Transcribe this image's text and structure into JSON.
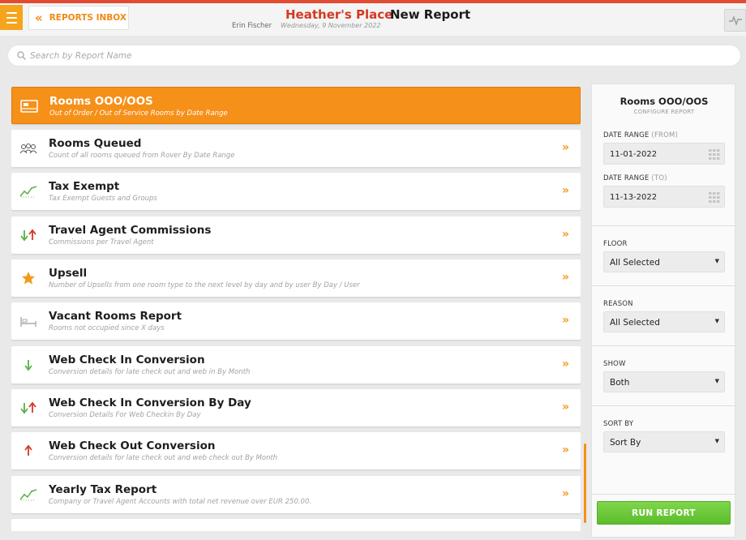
{
  "header": {
    "back_label": "REPORTS INBOX",
    "hotel_name": "Heather's Place",
    "page_title": "New Report",
    "user_name": "Erin Fischer",
    "date": "Wednesday, 9 November 2022"
  },
  "search": {
    "placeholder": "Search by Report Name",
    "value": ""
  },
  "reports": [
    {
      "title": "Rooms OOO/OOS",
      "subtitle": "Out of Order / Out of Service Rooms by Date Range",
      "icon": "room-icon",
      "selected": true
    },
    {
      "title": "Rooms Queued",
      "subtitle": "Count of all rooms queued from Rover By Date Range",
      "icon": "people-queue-icon",
      "selected": false
    },
    {
      "title": "Tax Exempt",
      "subtitle": "Tax Exempt Guests and Groups",
      "icon": "trend-chart-icon",
      "selected": false
    },
    {
      "title": "Travel Agent Commissions",
      "subtitle": "Commissions per Travel Agent",
      "icon": "up-down-arrows-icon",
      "selected": false
    },
    {
      "title": "Upsell",
      "subtitle": "Number of Upsells from one room type to the next level by day and by user By Day / User",
      "icon": "star-icon",
      "selected": false
    },
    {
      "title": "Vacant Rooms Report",
      "subtitle": "Rooms not occupied since X days",
      "icon": "bed-icon",
      "selected": false
    },
    {
      "title": "Web Check In Conversion",
      "subtitle": "Conversion details for late check out and web in By Month",
      "icon": "down-arrow-icon",
      "selected": false
    },
    {
      "title": "Web Check In Conversion By Day",
      "subtitle": "Conversion Details For Web Checkin By Day",
      "icon": "up-down-arrows-icon",
      "selected": false
    },
    {
      "title": "Web Check Out Conversion",
      "subtitle": "Conversion details for late check out and web check out By Month",
      "icon": "up-arrow-icon",
      "selected": false
    },
    {
      "title": "Yearly Tax Report",
      "subtitle": "Company or Travel Agent Accounts with total net revenue over EUR 250.00.",
      "icon": "trend-chart-icon",
      "selected": false
    }
  ],
  "config": {
    "title": "Rooms OOO/OOS",
    "subtitle": "CONFIGURE REPORT",
    "date_from_label": "DATE RANGE",
    "date_from_hint": "(FROM)",
    "date_from_value": "11-01-2022",
    "date_to_label": "DATE RANGE",
    "date_to_hint": "(TO)",
    "date_to_value": "11-13-2022",
    "floor_label": "FLOOR",
    "floor_value": "All Selected",
    "reason_label": "REASON",
    "reason_value": "All Selected",
    "show_label": "SHOW",
    "show_value": "Both",
    "sort_label": "SORT BY",
    "sort_value": "Sort By",
    "run_label": "RUN REPORT"
  },
  "colors": {
    "accent": "#f59019",
    "brand_red": "#d33a22",
    "run_green": "#6ac93a"
  }
}
